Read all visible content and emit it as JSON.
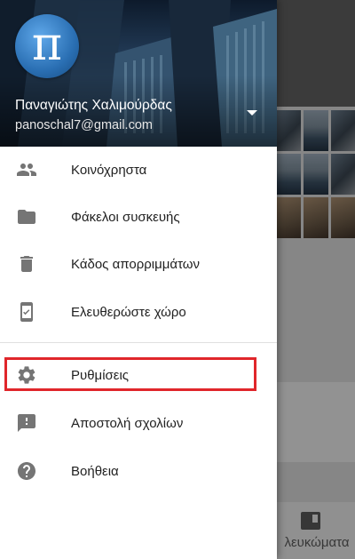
{
  "account": {
    "name": "Παναγιώτης Χαλιμούρδας",
    "email": "panoschal7@gmail.com",
    "avatar_glyph": "π"
  },
  "menu": {
    "group1": [
      {
        "label": "Κοινόχρηστα",
        "icon": "people-icon"
      },
      {
        "label": "Φάκελοι συσκευής",
        "icon": "folder-icon"
      },
      {
        "label": "Κάδος απορριμμάτων",
        "icon": "trash-icon"
      },
      {
        "label": "Ελευθερώστε χώρο",
        "icon": "phone-free-space-icon"
      }
    ],
    "group2": [
      {
        "label": "Ρυθμίσεις",
        "icon": "gear-icon",
        "highlighted": true
      },
      {
        "label": "Αποστολή σχολίων",
        "icon": "feedback-icon"
      },
      {
        "label": "Βοήθεια",
        "icon": "help-icon"
      }
    ]
  },
  "background_app": {
    "bottom_nav_label": "λευκώματα"
  },
  "colors": {
    "icon_gray": "#757575",
    "highlight_red": "#e0262b",
    "text_primary": "#212121"
  }
}
